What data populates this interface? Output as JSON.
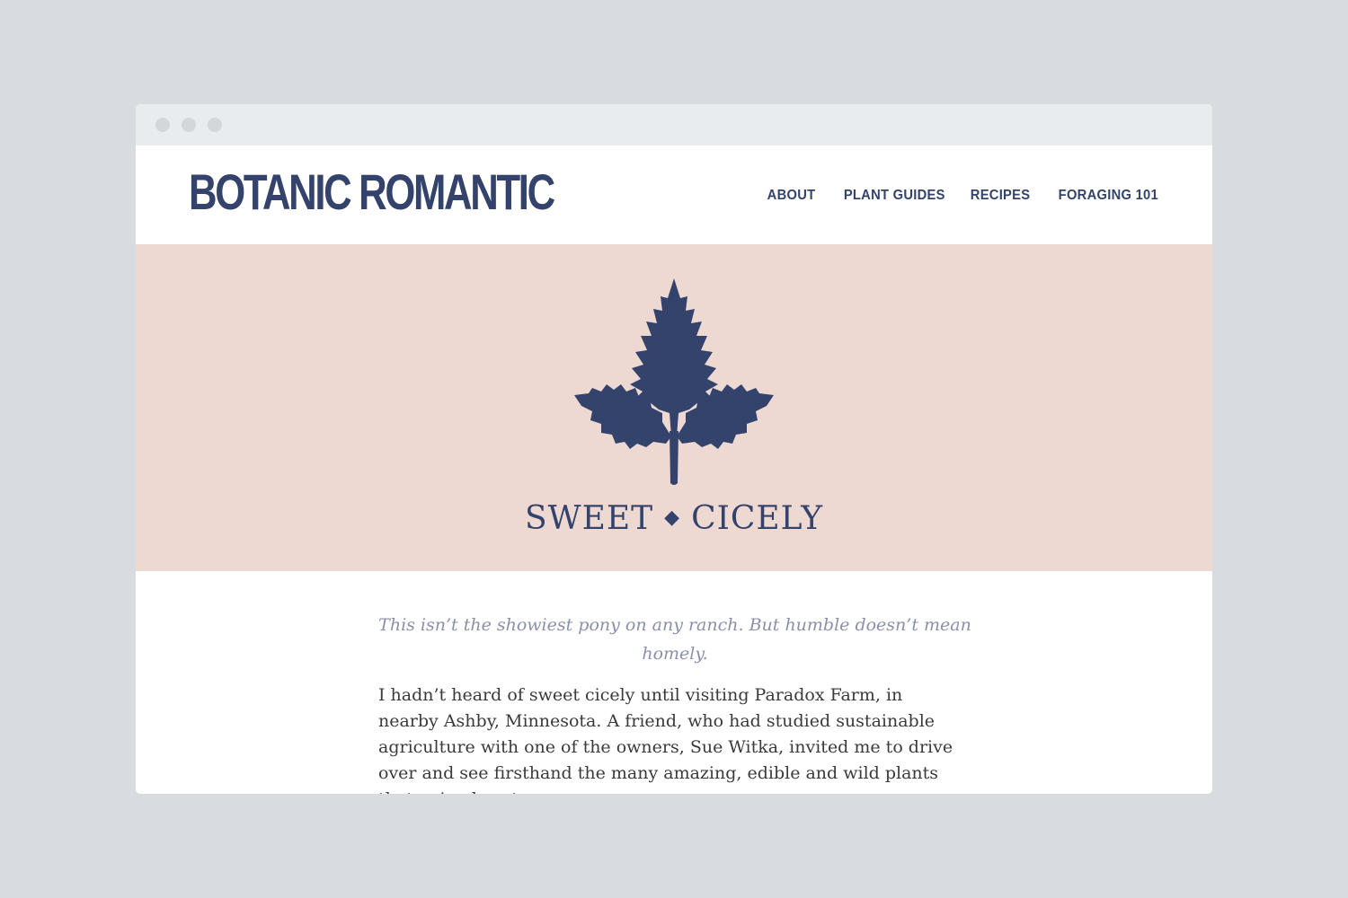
{
  "window": {
    "controls": [
      "close",
      "minimize",
      "maximize"
    ]
  },
  "site": {
    "logo": "BOTANIC ROMANTIC",
    "nav": [
      {
        "label": "ABOUT"
      },
      {
        "label": "PLANT GUIDES"
      },
      {
        "label": "RECIPES"
      },
      {
        "label": "FORAGING 101"
      }
    ]
  },
  "hero": {
    "icon": "leaf-icon",
    "title_left": "SWEET",
    "title_separator": "◆",
    "title_right": "CICELY"
  },
  "article": {
    "lede": "This isn’t the showiest pony on any ranch. But humble doesn’t mean homely.",
    "body": "I hadn’t heard of sweet cicely until visiting Paradox Farm, in nearby Ashby, Minnesota. A friend, who had studied sustainable agriculture with one of the owners, Sue Witka, invited me to drive over and see firsthand the many amazing, edible and wild plants that animals eat"
  },
  "colors": {
    "background": "#d8dbe0",
    "titlebar": "#e9ecef",
    "brand_navy": "#34436b",
    "hero_pink": "#eed9d2",
    "lede_gray": "#8b8fa8",
    "body_text": "#3a3a3a"
  }
}
